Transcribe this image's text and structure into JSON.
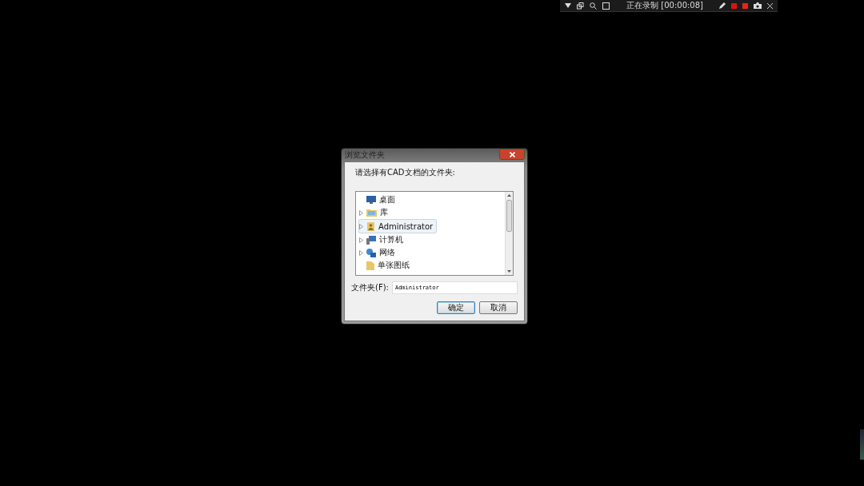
{
  "recorder_bar": {
    "status": "正在录制 [00:00:08]"
  },
  "dialog": {
    "title": "浏览文件夹",
    "prompt": "请选择有CAD文档的文件夹:",
    "tree": [
      {
        "label": "桌面",
        "kind": "desktop",
        "expandable": false,
        "selected": false
      },
      {
        "label": "库",
        "kind": "library",
        "expandable": true,
        "selected": false
      },
      {
        "label": "Administrator",
        "kind": "user",
        "expandable": true,
        "selected": true
      },
      {
        "label": "计算机",
        "kind": "computer",
        "expandable": true,
        "selected": false
      },
      {
        "label": "网络",
        "kind": "network",
        "expandable": true,
        "selected": false
      },
      {
        "label": "单张图纸",
        "kind": "folder",
        "expandable": false,
        "selected": false
      }
    ],
    "folder_label": "文件夹(F):",
    "folder_value": "Administrator",
    "buttons": [
      {
        "label": "确定",
        "default": true
      },
      {
        "label": "取消",
        "default": false
      }
    ]
  }
}
